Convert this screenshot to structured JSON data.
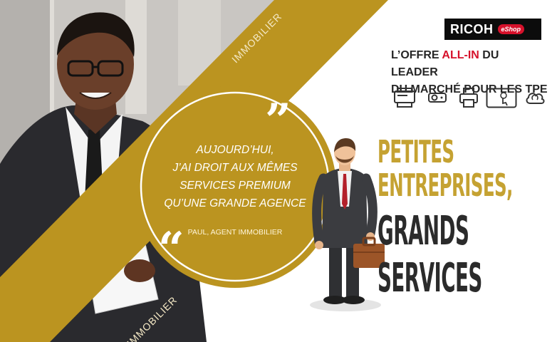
{
  "band": {
    "top_label": "IMMOBILIER",
    "bottom_label": "IMMOBILIER",
    "color": "#bb9420"
  },
  "quote": {
    "lines": [
      "Aujourd’hui,",
      "j’ai droit aux mêmes",
      "services premium",
      "qu’une grande agence"
    ],
    "author": "Paul, agent immobilier",
    "open_mark": "”",
    "close_mark": "“"
  },
  "brand": {
    "name": "RICOH",
    "badge": "eShop",
    "badge_color": "#d6112b"
  },
  "offer": {
    "line1_prefix": "L’offre ",
    "line1_accent": "ALL-IN",
    "line1_suffix": " du leader",
    "line2": "du marché pour les TPE",
    "accent_color": "#d6112b"
  },
  "product_icons": [
    "multifunction-printer-icon",
    "projector-icon",
    "printer-icon",
    "interactive-display-icon",
    "cloud-sync-icon"
  ],
  "headline": {
    "line1": "Petites",
    "line2": "entreprises,",
    "line3": "grands",
    "line4": "services",
    "gold_color": "#c5a232",
    "dark_color": "#2b2b2b"
  }
}
